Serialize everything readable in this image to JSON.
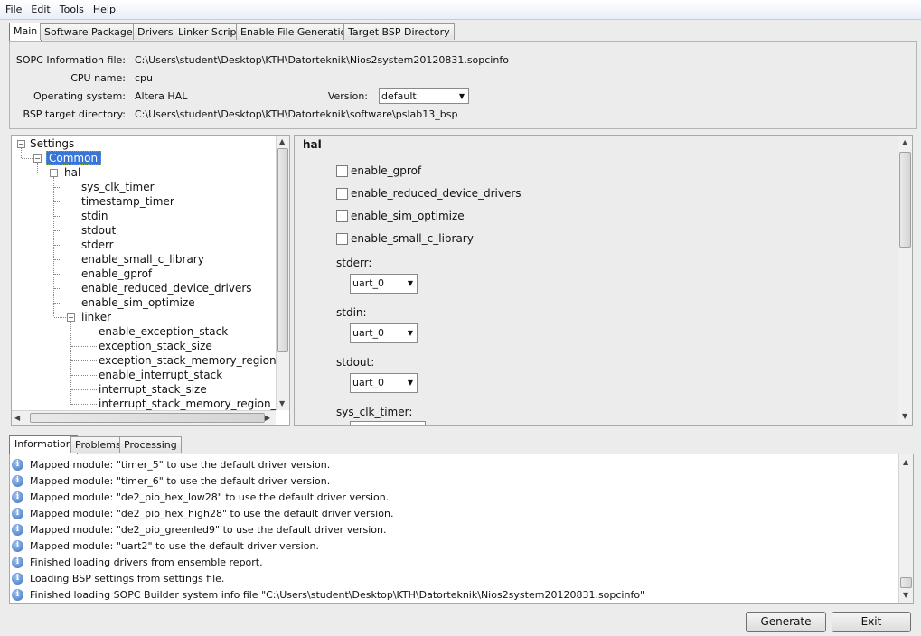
{
  "menu": [
    "File",
    "Edit",
    "Tools",
    "Help"
  ],
  "tabs": [
    "Main",
    "Software Packages",
    "Drivers",
    "Linker Script",
    "Enable File Generation",
    "Target BSP Directory"
  ],
  "main": {
    "sopc_label": "SOPC Information file:",
    "sopc_value": "C:\\Users\\student\\Desktop\\KTH\\Datorteknik\\Nios2system20120831.sopcinfo",
    "cpu_label": "CPU name:",
    "cpu_value": "cpu",
    "os_label": "Operating system:",
    "os_value": "Altera HAL",
    "version_label": "Version:",
    "version_value": "default",
    "bsp_label": "BSP target directory:",
    "bsp_value": "C:\\Users\\student\\Desktop\\KTH\\Datorteknik\\software\\pslab13_bsp"
  },
  "tree": {
    "root": "Settings",
    "common": "Common",
    "hal": "hal",
    "hal_items": [
      "sys_clk_timer",
      "timestamp_timer",
      "stdin",
      "stdout",
      "stderr",
      "enable_small_c_library",
      "enable_gprof",
      "enable_reduced_device_drivers",
      "enable_sim_optimize"
    ],
    "linker": "linker",
    "linker_items": [
      "enable_exception_stack",
      "exception_stack_size",
      "exception_stack_memory_region_n",
      "enable_interrupt_stack",
      "interrupt_stack_size",
      "interrupt_stack_memory_region_na"
    ]
  },
  "settings": {
    "group": "hal",
    "checkboxes": [
      "enable_gprof",
      "enable_reduced_device_drivers",
      "enable_sim_optimize",
      "enable_small_c_library"
    ],
    "stderr_label": "stderr:",
    "stderr_value": "uart_0",
    "stdin_label": "stdin:",
    "stdin_value": "uart_0",
    "stdout_label": "stdout:",
    "stdout_value": "uart_0",
    "sys_clk_label": "sys_clk_timer:"
  },
  "bottom_tabs": [
    "Information",
    "Problems",
    "Processing"
  ],
  "log": [
    "Mapped module: \"timer_5\" to use the default driver version.",
    "Mapped module: \"timer_6\" to use the default driver version.",
    "Mapped module: \"de2_pio_hex_low28\" to use the default driver version.",
    "Mapped module: \"de2_pio_hex_high28\" to use the default driver version.",
    "Mapped module: \"de2_pio_greenled9\" to use the default driver version.",
    "Mapped module: \"uart2\" to use the default driver version.",
    "Finished loading drivers from ensemble report.",
    "Loading BSP settings from settings file.",
    "Finished loading SOPC Builder system info file \"C:\\Users\\student\\Desktop\\KTH\\Datorteknik\\Nios2system20120831.sopcinfo\""
  ],
  "buttons": {
    "generate": "Generate",
    "exit": "Exit"
  },
  "icons": {
    "info": "info-icon",
    "expand": "minus-expander-icon",
    "dropdown": "chevron-down-icon"
  }
}
